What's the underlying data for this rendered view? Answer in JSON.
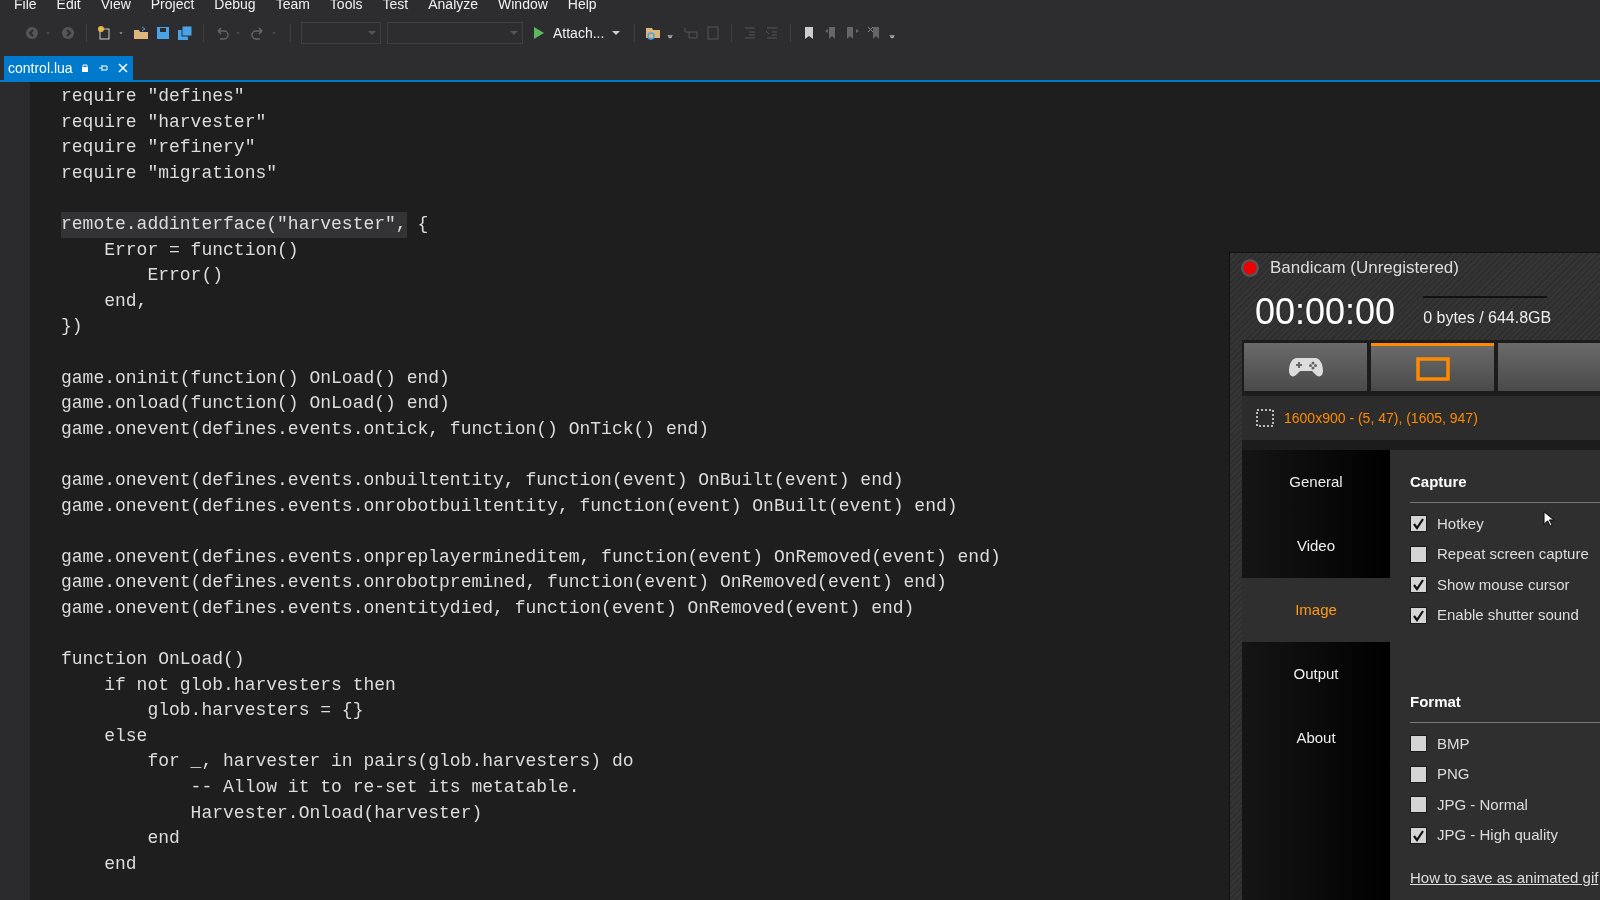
{
  "menu": [
    "File",
    "Edit",
    "View",
    "Project",
    "Debug",
    "Team",
    "Tools",
    "Test",
    "Analyze",
    "Window",
    "Help"
  ],
  "toolbar": {
    "attach": "Attach..."
  },
  "tabs": [
    {
      "label": "control.lua",
      "selected": true
    }
  ],
  "code": {
    "blocks": [
      [
        {
          "text": "require \"defines\""
        },
        {
          "text": "require \"harvester\""
        },
        {
          "text": "require \"refinery\""
        },
        {
          "text": "require \"migrations\""
        }
      ],
      [
        {
          "marked": "remote.addinterface(\"harvester\",",
          "text": " {"
        },
        {
          "text": "    Error = function()"
        },
        {
          "text": "        Error()"
        },
        {
          "text": "    end,"
        },
        {
          "text": "})"
        }
      ],
      [
        {
          "text": "game.oninit(function() OnLoad() end)"
        },
        {
          "text": "game.onload(function() OnLoad() end)"
        },
        {
          "text": "game.onevent(defines.events.ontick, function() OnTick() end)"
        }
      ],
      [
        {
          "text": "game.onevent(defines.events.onbuiltentity, function(event) OnBuilt(event) end)"
        },
        {
          "text": "game.onevent(defines.events.onrobotbuiltentity, function(event) OnBuilt(event) end)"
        }
      ],
      [
        {
          "text": "game.onevent(defines.events.onpreplayermineditem, function(event) OnRemoved(event) end)"
        },
        {
          "text": "game.onevent(defines.events.onrobotpremined, function(event) OnRemoved(event) end)"
        },
        {
          "text": "game.onevent(defines.events.onentitydied, function(event) OnRemoved(event) end)"
        }
      ],
      [
        {
          "text": "function OnLoad()"
        },
        {
          "text": "    if not glob.harvesters then"
        },
        {
          "text": "        glob.harvesters = {}"
        },
        {
          "text": "    else"
        },
        {
          "text": "        for _, harvester in pairs(glob.harvesters) do"
        },
        {
          "text": "            -- Allow it to re-set its metatable."
        },
        {
          "text": "            Harvester.Onload(harvester)"
        },
        {
          "text": "        end"
        },
        {
          "text": "    end"
        }
      ]
    ]
  },
  "bandicam": {
    "title": "Bandicam (Unregistered)",
    "timer": "00:00:00",
    "size": "0 bytes / 644.8GB",
    "modes": [
      {
        "kind": "game",
        "selected": false
      },
      {
        "kind": "screen",
        "selected": true
      },
      {
        "kind": "blank",
        "selected": false
      }
    ],
    "region": "1600x900 - (5, 47), (1605, 947)",
    "nav": [
      {
        "label": "General",
        "selected": false
      },
      {
        "label": "Video",
        "selected": false
      },
      {
        "label": "Image",
        "selected": true
      },
      {
        "label": "Output",
        "selected": false
      },
      {
        "label": "About",
        "selected": false
      }
    ],
    "sections": [
      {
        "title": "Capture",
        "options": [
          {
            "label": "Hotkey",
            "checked": true
          },
          {
            "label": "Repeat screen capture",
            "checked": false
          },
          {
            "label": "Show mouse cursor",
            "checked": true
          },
          {
            "label": "Enable shutter sound",
            "checked": true
          }
        ]
      },
      {
        "title": "Format",
        "options": [
          {
            "label": "BMP",
            "checked": false
          },
          {
            "label": "PNG",
            "checked": false
          },
          {
            "label": "JPG - Normal",
            "checked": false
          },
          {
            "label": "JPG - High quality",
            "checked": true
          }
        ]
      }
    ],
    "link": "How to save as animated gif"
  }
}
